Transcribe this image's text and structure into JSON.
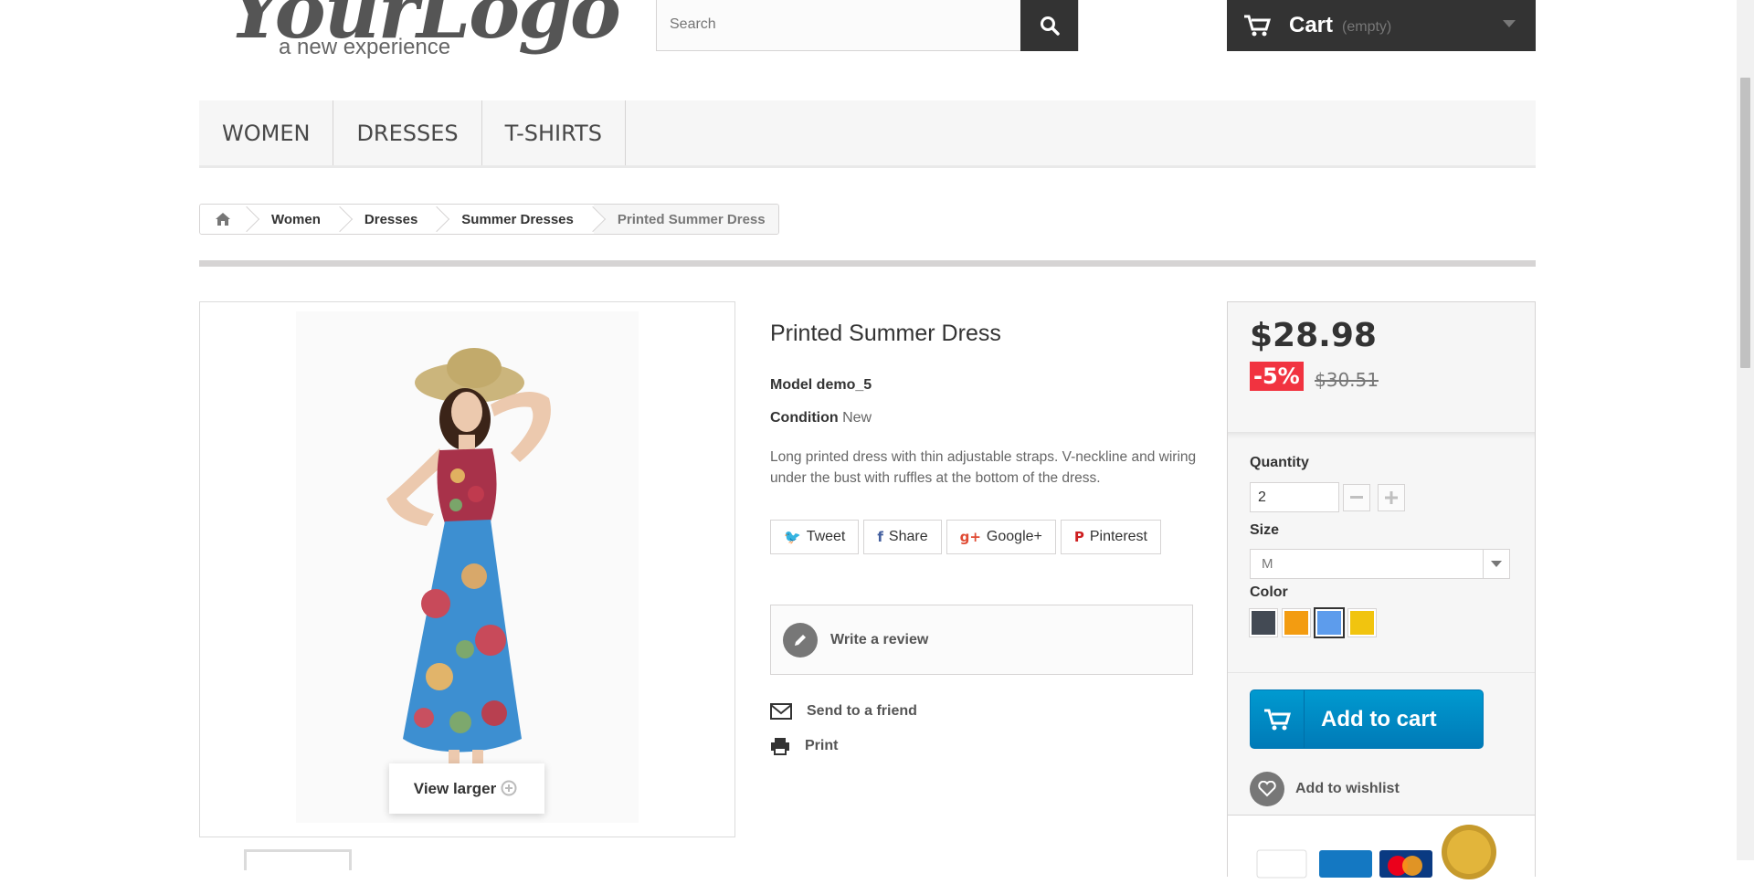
{
  "logo": {
    "main": "YourLogo",
    "tagline": "a new experience"
  },
  "search": {
    "placeholder": "Search"
  },
  "cart": {
    "label": "Cart",
    "status": "(empty)"
  },
  "menu": [
    {
      "label": "WOMEN"
    },
    {
      "label": "DRESSES"
    },
    {
      "label": "T-SHIRTS"
    }
  ],
  "breadcrumb": [
    {
      "label": "Women"
    },
    {
      "label": "Dresses"
    },
    {
      "label": "Summer Dresses"
    },
    {
      "label": "Printed Summer Dress"
    }
  ],
  "product": {
    "title": "Printed Summer Dress",
    "model_label": "Model",
    "model_value": "demo_5",
    "condition_label": "Condition",
    "condition_value": "New",
    "description": "Long printed dress with thin adjustable straps. V-neckline and wiring under the bust with ruffles at the bottom of the dress.",
    "view_larger": "View larger"
  },
  "share": [
    {
      "label": "Tweet",
      "icon": "twitter-icon",
      "glyph": "🐦",
      "color": "#00aaf0"
    },
    {
      "label": "Share",
      "icon": "facebook-icon",
      "glyph": "f",
      "color": "#435f9f"
    },
    {
      "label": "Google+",
      "icon": "google-plus-icon",
      "glyph": "g+",
      "color": "#e04b34"
    },
    {
      "label": "Pinterest",
      "icon": "pinterest-icon",
      "glyph": "P",
      "color": "#ce1f21"
    }
  ],
  "actions": {
    "write_review": "Write a review",
    "send_friend": "Send to a friend",
    "print": "Print"
  },
  "buy": {
    "price": "$28.98",
    "discount": "-5%",
    "old_price": "$30.51",
    "quantity_label": "Quantity",
    "quantity_value": "2",
    "size_label": "Size",
    "size_value": "M",
    "color_label": "Color",
    "colors": [
      "#434a54",
      "#f39c11",
      "#5d9cec",
      "#f1c40f"
    ],
    "selected_color": "#5d9cec",
    "add_to_cart": "Add to cart",
    "add_to_wishlist": "Add to wishlist"
  },
  "colors": {
    "dark": "#333333",
    "accent_blue": "#009ad0",
    "discount_red": "#f13340"
  }
}
